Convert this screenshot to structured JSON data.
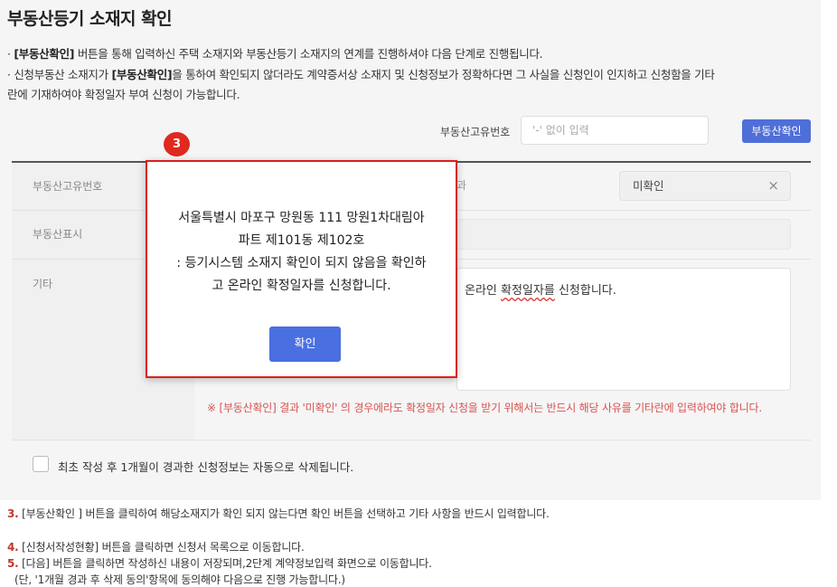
{
  "page": {
    "title": "부동산등기 소재지 확인",
    "desc1_prefix": "· ",
    "desc1_bold": "[부동산확인]",
    "desc1_rest": " 버튼을 통해 입력하신 주택 소재지와 부동산등기 소재지의 연계를 진행하셔야 다음 단계로 진행됩니다.",
    "desc2_prefix": "· 신청부동산 소재지가 ",
    "desc2_bold": "[부동산확인]",
    "desc2_rest": "을 통하여 확인되지 않더라도 계약증서상 소재지 및 신청정보가 정확하다면 그 사실을 신청인이 인지하고 신청함을 기타",
    "desc3": "란에 기재하여야 확정일자 부여 신청이 가능합니다."
  },
  "search": {
    "label": "부동산고유번호",
    "placeholder": "'-' 없이 입력",
    "button": "부동산확인"
  },
  "form": {
    "row1_label": "부동산고유번호",
    "row1_right_label": "과",
    "status_value": "미확인",
    "close_symbol": "×",
    "row2_label": "부동산표시",
    "row3_label": "기타",
    "etc_text_plain": "온라인 ",
    "etc_text_squiggle": "확정일자를",
    "etc_text_end": " 신청합니다.",
    "warn": "※ [부동산확인] 결과 '미확인' 의 경우에라도 확정일자 신청을 받기 위해서는 반드시 해당 사유를 기타란에 입력하여야 합니다.",
    "checkbox_label": "최초 작성 후 1개월이 경과한 신청정보는 자동으로 삭제됩니다."
  },
  "badge": "3",
  "modal": {
    "line1": "서울특별시 마포구 망원동 111 망원1차대림아",
    "line2": "파트 제101동 제102호",
    "line3": ": 등기시스템 소재지 확인이 되지 않음을 확인하",
    "line4": "고 온라인 확정일자를 신청합니다.",
    "button": "확인"
  },
  "notes": [
    {
      "num": "3.",
      "text": " [부동산확인 ] 버튼을 클릭하여 해당소재지가 확인 되지 않는다면 확인 버튼을 선택하고 기타 사항을 반드시 입력합니다."
    },
    {
      "num": "4.",
      "text": " [신청서작성현황] 버튼을 클릭하면 신청서 목록으로 이동합니다."
    },
    {
      "num": "5.",
      "text": " [다음] 버튼을 클릭하면 작성하신 내용이 저장되며,2단계 계약정보입력 화면으로 이동합니다."
    }
  ],
  "note_sub": "(단, '1개월 경과 후 삭제 동의'항목에 동의해야 다음으로 진행 가능합니다.)",
  "colors": {
    "accent": "#4f6fd8",
    "highlight_border": "#d9201b",
    "badge": "#e0291f",
    "warning_text": "#d9534f"
  }
}
